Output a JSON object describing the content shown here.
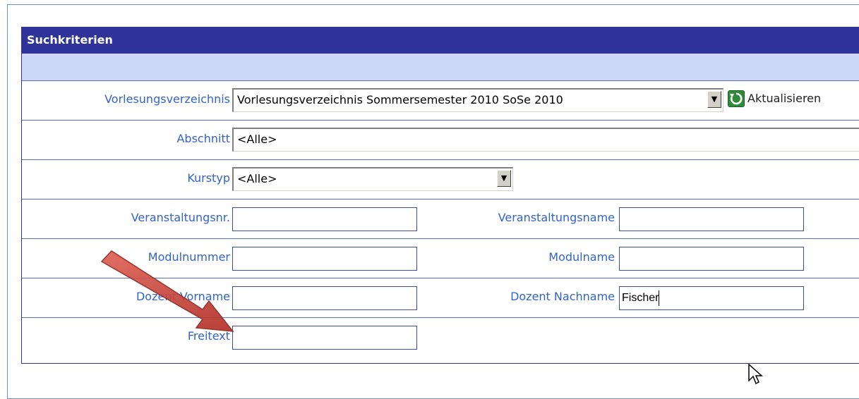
{
  "panel": {
    "title": "Suchkriterien"
  },
  "fields": {
    "vorlesungsverzeichnis": {
      "label": "Vorlesungsverzeichnis",
      "value": "Vorlesungsverzeichnis Sommersemester 2010 SoSe 2010",
      "refresh_label": "Aktualisieren"
    },
    "abschnitt": {
      "label": "Abschnitt",
      "value": "<Alle>"
    },
    "kurstyp": {
      "label": "Kurstyp",
      "value": "<Alle>"
    },
    "veranstaltungsnr": {
      "label": "Veranstaltungsnr.",
      "value": ""
    },
    "veranstaltungsname": {
      "label": "Veranstaltungsname",
      "value": ""
    },
    "modulnummer": {
      "label": "Modulnummer",
      "value": ""
    },
    "modulname": {
      "label": "Modulname",
      "value": ""
    },
    "dozent_vorname": {
      "label": "Dozent Vorname",
      "value": ""
    },
    "dozent_nachname": {
      "label": "Dozent Nachname",
      "value": "Fischer"
    },
    "freitext": {
      "label": "Freitext",
      "value": ""
    }
  },
  "colors": {
    "header_bg": "#303399",
    "subheader_bg": "#ccd7f7",
    "label_text": "#3363c9",
    "arrow": "#c0392b"
  },
  "icons": [
    "refresh-icon",
    "dropdown-arrow-icon",
    "annotation-arrow",
    "mouse-cursor-icon"
  ]
}
